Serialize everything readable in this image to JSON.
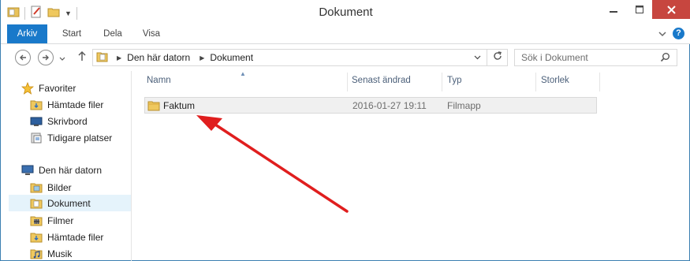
{
  "window": {
    "title": "Dokument"
  },
  "ribbon": {
    "tabs": [
      "Arkiv",
      "Start",
      "Dela",
      "Visa"
    ]
  },
  "address": {
    "breadcrumbs": [
      "Den här datorn",
      "Dokument"
    ]
  },
  "search": {
    "placeholder": "Sök i Dokument"
  },
  "navpane": {
    "items": [
      {
        "label": "Favoriter",
        "icon": "star-icon"
      },
      {
        "label": "Hämtade filer",
        "icon": "downloads-folder-icon"
      },
      {
        "label": "Skrivbord",
        "icon": "desktop-icon"
      },
      {
        "label": "Tidigare platser",
        "icon": "recent-places-icon"
      },
      {
        "label": "Den här datorn",
        "icon": "computer-icon"
      },
      {
        "label": "Bilder",
        "icon": "pictures-folder-icon"
      },
      {
        "label": "Dokument",
        "icon": "documents-folder-icon",
        "selected": true
      },
      {
        "label": "Filmer",
        "icon": "videos-folder-icon"
      },
      {
        "label": "Hämtade filer",
        "icon": "downloads-folder-icon"
      },
      {
        "label": "Musik",
        "icon": "music-folder-icon"
      }
    ]
  },
  "content": {
    "columns": [
      "Namn",
      "Senast ändrad",
      "Typ",
      "Storlek"
    ],
    "rows": [
      {
        "name": "Faktum",
        "modified": "2016-01-27 19:11",
        "type": "Filmapp",
        "size": ""
      }
    ]
  },
  "colors": {
    "accent": "#1979ca",
    "close": "#c7463f",
    "annotation_arrow": "#e01e1e",
    "selection": "#e5f3fb"
  }
}
